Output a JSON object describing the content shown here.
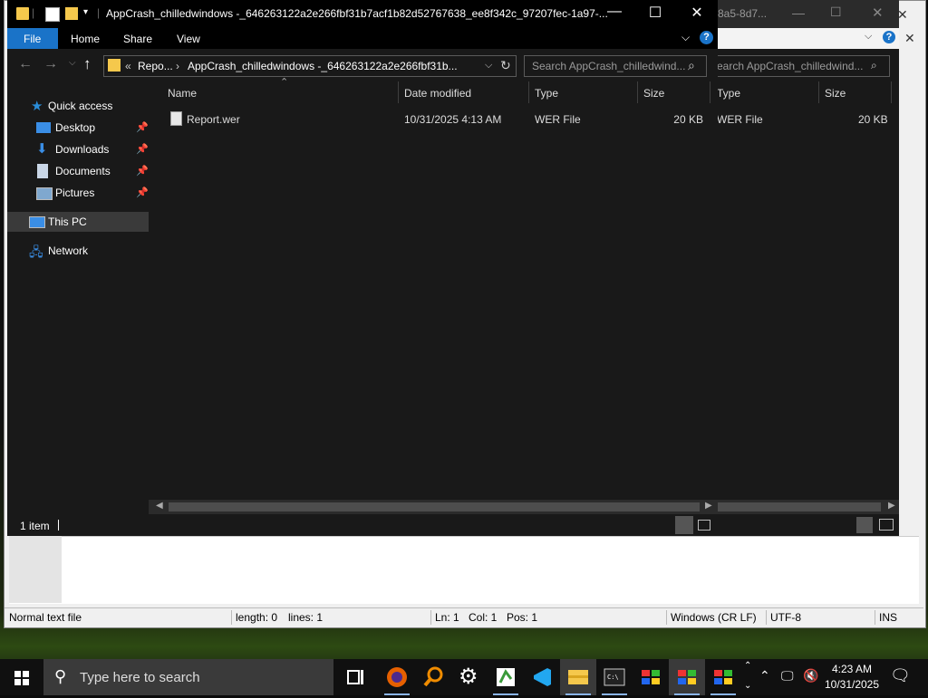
{
  "explorer": {
    "title": "AppCrash_chilledwindows -_646263122a2e266fbf31b7acf1b82d52767638_ee8f342c_97207fec-1a97-...",
    "ribbon_tabs": [
      "File",
      "Home",
      "Share",
      "View"
    ],
    "address": {
      "crumb_prefix": "«",
      "crumb_1": "Repo...",
      "crumb_sep": "›",
      "crumb_2": "AppCrash_chilledwindows -_646263122a2e266fbf31b..."
    },
    "search_placeholder": "Search AppCrash_chilledwind...",
    "columns": {
      "name": "Name",
      "date": "Date modified",
      "type": "Type",
      "size": "Size"
    },
    "files": [
      {
        "name": "Report.wer",
        "date": "10/31/2025 4:13 AM",
        "type": "WER File",
        "size": "20 KB"
      }
    ],
    "nav": {
      "quick_access": "Quick access",
      "desktop": "Desktop",
      "downloads": "Downloads",
      "documents": "Documents",
      "pictures": "Pictures",
      "this_pc": "This PC",
      "network": "Network"
    },
    "status": "1 item"
  },
  "explorer_behind": {
    "title_fragment": "8a5-8d7...",
    "search_placeholder": "earch AppCrash_chilledwind...",
    "col_type": "Type",
    "col_size": "Size",
    "file_type": "WER File",
    "file_size": "20 KB"
  },
  "notepad_status": {
    "file_type": "Normal text file",
    "length": "length: 0",
    "lines": "lines: 1",
    "ln": "Ln: 1",
    "col": "Col: 1",
    "pos": "Pos: 1",
    "eol": "Windows (CR LF)",
    "encoding": "UTF-8",
    "mode": "INS"
  },
  "taskbar": {
    "search_placeholder": "Type here to search",
    "time": "4:23 AM",
    "date": "10/31/2025",
    "icons": [
      "task-view-icon",
      "firefox-icon",
      "search-app-icon",
      "settings-icon",
      "notepad-plus-icon",
      "vscode-icon",
      "file-explorer-icon",
      "terminal-icon",
      "windows-app-icon",
      "windows-app-icon",
      "windows-app-icon"
    ]
  },
  "colors": {
    "accent": "#1a73c8",
    "window_bg": "#191919",
    "titlebar": "#000000"
  }
}
